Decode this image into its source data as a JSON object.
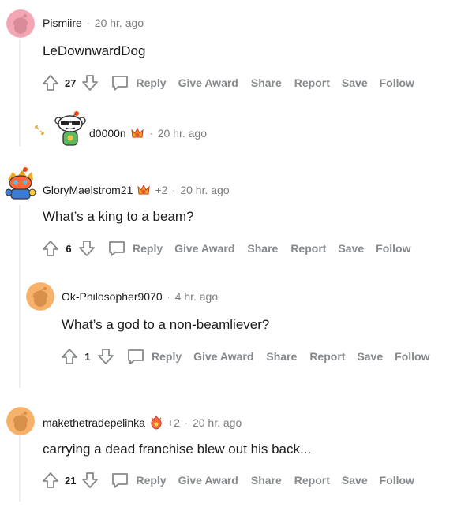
{
  "comments": [
    {
      "username": "Pismiire",
      "time": "20 hr. ago",
      "body": "LeDownwardDog",
      "score": "27",
      "reply_label": "Reply",
      "award_label": "Give Award",
      "share_label": "Share",
      "report_label": "Report",
      "save_label": "Save",
      "follow_label": "Follow",
      "avatar_color": "#f3a7b4"
    },
    {
      "username": "d0000n",
      "time": "20 hr. ago",
      "collapsed": true
    },
    {
      "username": "GloryMaelstrom21",
      "award_count": "+2",
      "time": "20 hr. ago",
      "body": "What’s a king to a beam?",
      "score": "6",
      "reply_label": "Reply",
      "award_label": "Give Award",
      "share_label": "Share",
      "report_label": "Report",
      "save_label": "Save",
      "follow_label": "Follow"
    },
    {
      "username": "Ok-Philosopher9070",
      "time": "4 hr. ago",
      "body": "What’s a god to a non-beamliever?",
      "score": "1",
      "reply_label": "Reply",
      "award_label": "Give Award",
      "share_label": "Share",
      "report_label": "Report",
      "save_label": "Save",
      "follow_label": "Follow",
      "avatar_color": "#f6b26b"
    },
    {
      "username": "makethetradepelinka",
      "award_count": "+2",
      "time": "20 hr. ago",
      "body": "carrying a dead franchise blew out his back...",
      "score": "21",
      "reply_label": "Reply",
      "award_label": "Give Award",
      "share_label": "Share",
      "report_label": "Report",
      "save_label": "Save",
      "follow_label": "Follow",
      "avatar_color": "#f6b26b"
    }
  ],
  "separator": "·",
  "colors": {
    "meta_gray": "#7c7c7c",
    "action_gray": "#878a8c",
    "thread_line": "#edeff1",
    "award_orange": "#e8542a"
  }
}
